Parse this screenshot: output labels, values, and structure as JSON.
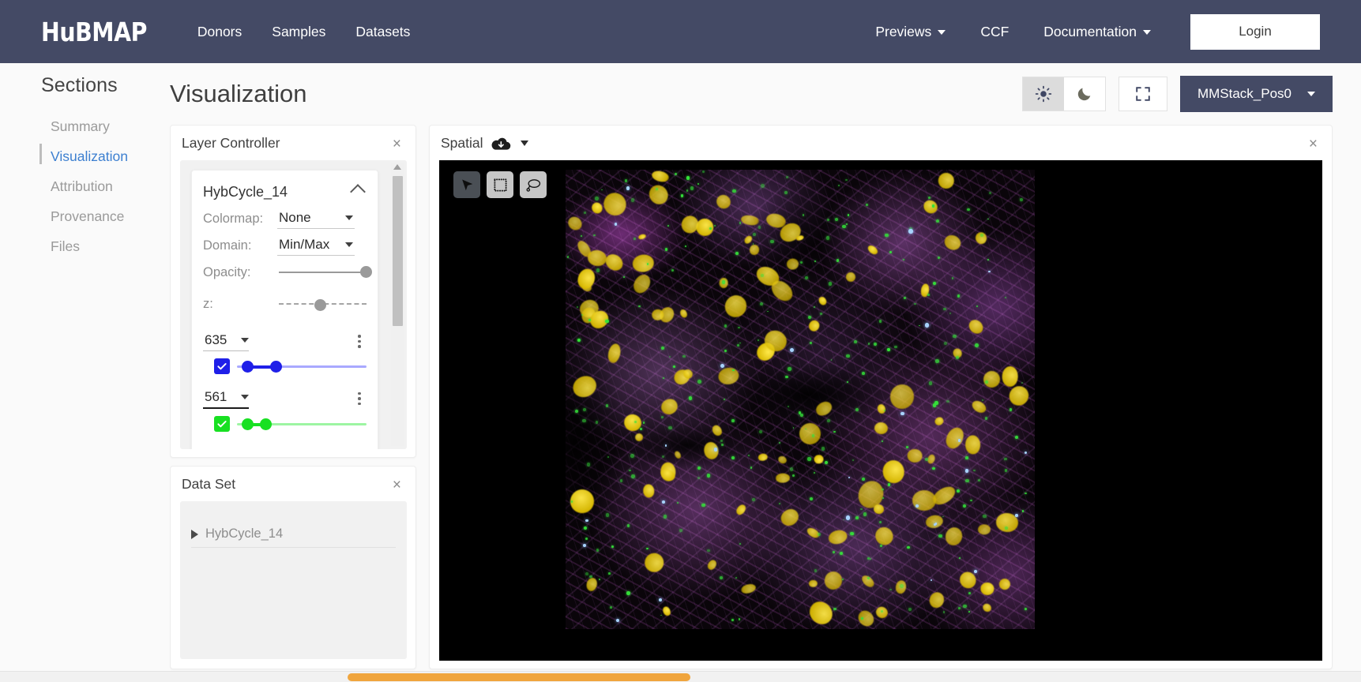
{
  "navbar": {
    "brand": "HuBMAP",
    "links": [
      {
        "label": "Donors"
      },
      {
        "label": "Samples"
      },
      {
        "label": "Datasets"
      }
    ],
    "right_links": [
      {
        "label": "Previews",
        "has_caret": true
      },
      {
        "label": "CCF",
        "has_caret": false
      },
      {
        "label": "Documentation",
        "has_caret": true
      }
    ],
    "login_label": "Login",
    "bg_color": "#444a65"
  },
  "sidebar": {
    "title": "Sections",
    "items": [
      {
        "label": "Summary",
        "active": false
      },
      {
        "label": "Visualization",
        "active": true
      },
      {
        "label": "Attribution",
        "active": false
      },
      {
        "label": "Provenance",
        "active": false
      },
      {
        "label": "Files",
        "active": false
      }
    ],
    "active_color": "#3c7fd0"
  },
  "main": {
    "page_title": "Visualization",
    "theme_toggle": {
      "light_label": "light-theme",
      "dark_label": "dark-theme",
      "selected": "light"
    },
    "fullscreen_label": "fullscreen",
    "stack_selector": {
      "label": "MMStack_Pos0",
      "has_caret": true
    }
  },
  "layer_controller": {
    "title": "Layer Controller",
    "close_label": "×",
    "layer": {
      "name": "HybCycle_14",
      "expanded": true,
      "colormap": {
        "label": "Colormap:",
        "value": "None"
      },
      "domain": {
        "label": "Domain:",
        "value": "Min/Max"
      },
      "opacity": {
        "label": "Opacity:",
        "value_pct": 100
      },
      "z": {
        "label": "z:",
        "value_pct": 48
      },
      "channels": [
        {
          "name": "635",
          "checked": true,
          "color": "#1f1fe8",
          "rail_color": "#a9a9ff",
          "low_pct": 8,
          "high_pct": 30,
          "focused": false
        },
        {
          "name": "561",
          "checked": true,
          "color": "#18e022",
          "rail_color": "#9df5a2",
          "low_pct": 8,
          "high_pct": 22,
          "focused": true
        }
      ]
    }
  },
  "data_set": {
    "title": "Data Set",
    "close_label": "×",
    "items": [
      {
        "label": "HybCycle_14"
      }
    ]
  },
  "spatial": {
    "title": "Spatial",
    "download_icon": "cloud-download-icon",
    "has_caret": true,
    "close_label": "×",
    "tools": [
      {
        "name": "pointer-tool",
        "active": true
      },
      {
        "name": "rectangle-select-tool",
        "active": false
      },
      {
        "name": "lasso-select-tool",
        "active": false
      }
    ]
  }
}
